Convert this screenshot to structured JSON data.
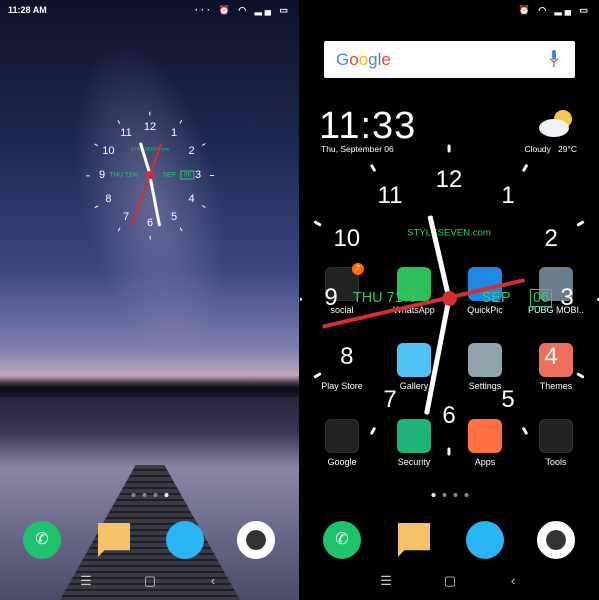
{
  "left_screen": {
    "status": {
      "time": "11:28 AM",
      "icons": [
        "more-dots-icon",
        "alarm-icon",
        "wifi-icon",
        "signal-icon",
        "battery-icon"
      ]
    },
    "clock_widget": {
      "numerals": [
        "12",
        "1",
        "2",
        "3",
        "4",
        "5",
        "6",
        "7",
        "8",
        "9",
        "10",
        "11"
      ],
      "brand": "STYLESEVEN.com",
      "day": "THU",
      "battery": "71%",
      "month": "SEP",
      "day_num": "06"
    },
    "page_dots": {
      "count": 4,
      "active": 4
    },
    "dock": [
      "phone",
      "messages",
      "browser",
      "camera"
    ]
  },
  "right_screen": {
    "status": {
      "icons": [
        "alarm-icon",
        "wifi-icon",
        "signal-icon",
        "battery-icon"
      ]
    },
    "search": {
      "logo": "Google",
      "mic": "mic-icon"
    },
    "time": "11:33",
    "date": "Thu, September 06",
    "weather": {
      "condition": "Cloudy",
      "temp": "29°C",
      "icon": "partly-cloudy-icon"
    },
    "clock_widget": {
      "numerals": [
        "12",
        "1",
        "2",
        "3",
        "4",
        "5",
        "6",
        "7",
        "8",
        "9",
        "10",
        "11"
      ],
      "brand": "STYLESEVEN.com",
      "day": "THU",
      "battery": "71%",
      "month": "SEP",
      "day_num": "06"
    },
    "apps": [
      {
        "label": "social",
        "badge": "2",
        "color": "#222"
      },
      {
        "label": "WhatsApp",
        "color": "#2fbf5a"
      },
      {
        "label": "QuickPic",
        "color": "#1e88e5"
      },
      {
        "label": "PUBG MOBI..",
        "color": "#6a7d8c"
      },
      {
        "label": "Play Store",
        "color": "#000"
      },
      {
        "label": "Gallery",
        "color": "#4fc3f7"
      },
      {
        "label": "Settings",
        "color": "#90a4ae"
      },
      {
        "label": "Themes",
        "color": "#ef6f5e"
      },
      {
        "label": "Google",
        "color": "#222"
      },
      {
        "label": "Security",
        "color": "#1fb37a"
      },
      {
        "label": "Apps",
        "color": "#ff7043"
      },
      {
        "label": "Tools",
        "color": "#222"
      }
    ],
    "page_dots": {
      "count": 4,
      "active": 1
    },
    "dock": [
      "phone",
      "messages",
      "browser",
      "camera"
    ]
  },
  "nav": {
    "menu": "☰",
    "home": "▢",
    "back": "‹"
  },
  "colors": {
    "accent_green": "#2ecc71",
    "second_hand": "#d32f2f",
    "phone": "#1ec36b",
    "messages": "#f9c06a",
    "browser": "#29b6f6"
  }
}
